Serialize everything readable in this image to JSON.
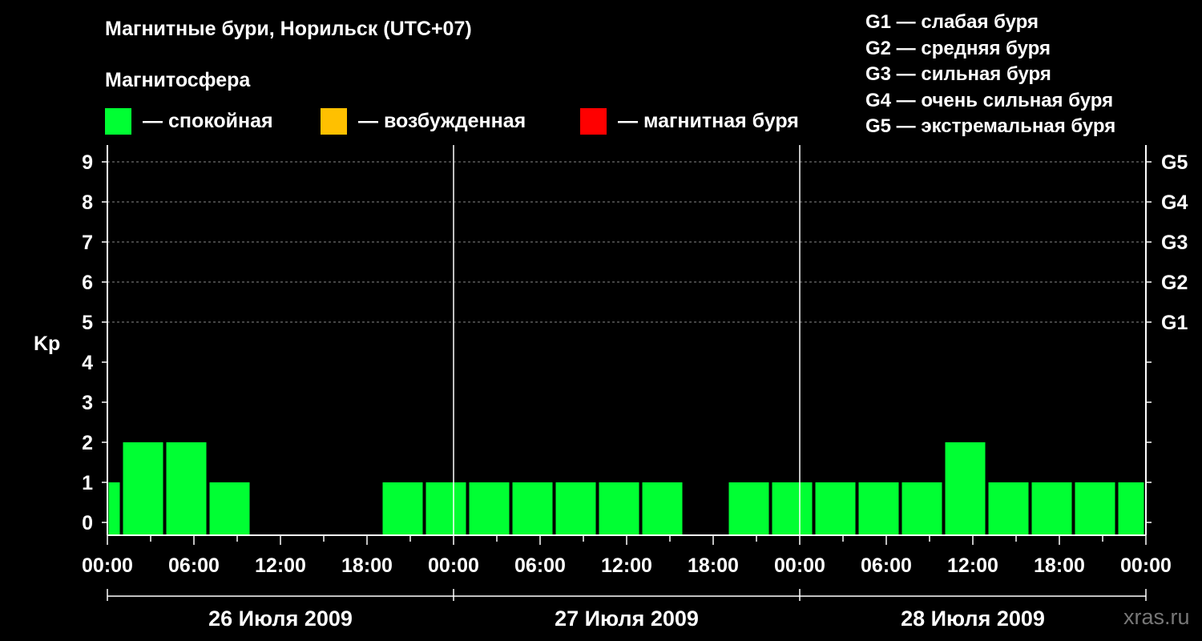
{
  "title": "Магнитные бури, Норильск (UTC+07)",
  "magnetosphere": {
    "label": "Магнитосфера",
    "legend": [
      {
        "text": "— спокойная",
        "color": "#00ff33"
      },
      {
        "text": "— возбужденная",
        "color": "#ffc000"
      },
      {
        "text": "— магнитная буря",
        "color": "#ff0000"
      }
    ]
  },
  "storm_levels": [
    "G1 — слабая буря",
    "G2 — средняя буря",
    "G3 — сильная буря",
    "G4 — очень сильная буря",
    "G5 — экстремальная буря"
  ],
  "watermark": "xras.ru",
  "chart_data": {
    "type": "bar",
    "ylabel": "Kp",
    "ylim": [
      0,
      9
    ],
    "y_ticks": [
      "0",
      "1",
      "2",
      "3",
      "4",
      "5",
      "6",
      "7",
      "8",
      "9"
    ],
    "right_ticks": [
      {
        "value": 5,
        "label": "G1"
      },
      {
        "value": 6,
        "label": "G2"
      },
      {
        "value": 7,
        "label": "G3"
      },
      {
        "value": 8,
        "label": "G4"
      },
      {
        "value": 9,
        "label": "G5"
      }
    ],
    "x_ticks": [
      "00:00",
      "06:00",
      "12:00",
      "18:00",
      "00:00",
      "06:00",
      "12:00",
      "18:00",
      "00:00",
      "06:00",
      "12:00",
      "18:00",
      "00:00"
    ],
    "dates": [
      "26 Июля 2009",
      "27 Июля 2009",
      "28 Июля 2009"
    ],
    "bar_color": "#00ff33",
    "grid": true,
    "series": [
      {
        "values": [
          {
            "start_hour": 0,
            "end_hour": 1,
            "kp": 1
          },
          {
            "start_hour": 1,
            "end_hour": 4,
            "kp": 2
          },
          {
            "start_hour": 4,
            "end_hour": 7,
            "kp": 2
          },
          {
            "start_hour": 7,
            "end_hour": 10,
            "kp": 1
          },
          {
            "start_hour": 19,
            "end_hour": 22,
            "kp": 1
          },
          {
            "start_hour": 22,
            "end_hour": 25,
            "kp": 1
          },
          {
            "start_hour": 25,
            "end_hour": 28,
            "kp": 1
          },
          {
            "start_hour": 28,
            "end_hour": 31,
            "kp": 1
          },
          {
            "start_hour": 31,
            "end_hour": 34,
            "kp": 1
          },
          {
            "start_hour": 34,
            "end_hour": 37,
            "kp": 1
          },
          {
            "start_hour": 37,
            "end_hour": 40,
            "kp": 1
          },
          {
            "start_hour": 43,
            "end_hour": 46,
            "kp": 1
          },
          {
            "start_hour": 46,
            "end_hour": 49,
            "kp": 1
          },
          {
            "start_hour": 49,
            "end_hour": 52,
            "kp": 1
          },
          {
            "start_hour": 52,
            "end_hour": 55,
            "kp": 1
          },
          {
            "start_hour": 55,
            "end_hour": 58,
            "kp": 1
          },
          {
            "start_hour": 58,
            "end_hour": 61,
            "kp": 2
          },
          {
            "start_hour": 61,
            "end_hour": 64,
            "kp": 1
          },
          {
            "start_hour": 64,
            "end_hour": 67,
            "kp": 1
          },
          {
            "start_hour": 67,
            "end_hour": 70,
            "kp": 1
          },
          {
            "start_hour": 70,
            "end_hour": 72,
            "kp": 1
          }
        ]
      }
    ]
  }
}
